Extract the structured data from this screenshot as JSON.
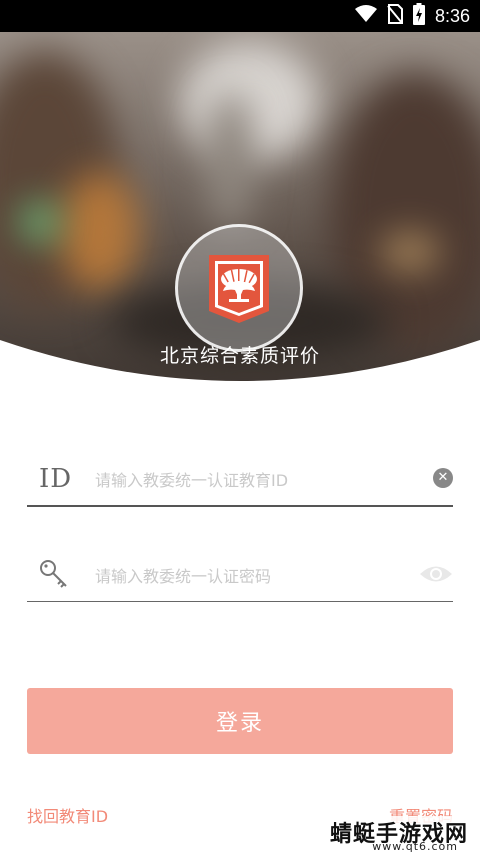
{
  "status_bar": {
    "time": "8:36",
    "icons": [
      "wifi-icon",
      "no-sim-icon",
      "battery-charging-icon"
    ]
  },
  "app": {
    "title": "北京综合素质评价"
  },
  "form": {
    "id_field": {
      "prefix": "ID",
      "placeholder": "请输入教委统一认证教育ID",
      "value": ""
    },
    "password_field": {
      "placeholder": "请输入教委统一认证密码",
      "value": ""
    },
    "login_label": "登录"
  },
  "links": {
    "recover_id": "找回教育ID",
    "reset_password": "重置密码"
  },
  "watermark": {
    "main": "蜻蜓手游戏网",
    "sub": "www.qt6.com"
  },
  "colors": {
    "accent": "#f28a78",
    "button": "#f5a89b",
    "logo_red": "#e3563d"
  }
}
